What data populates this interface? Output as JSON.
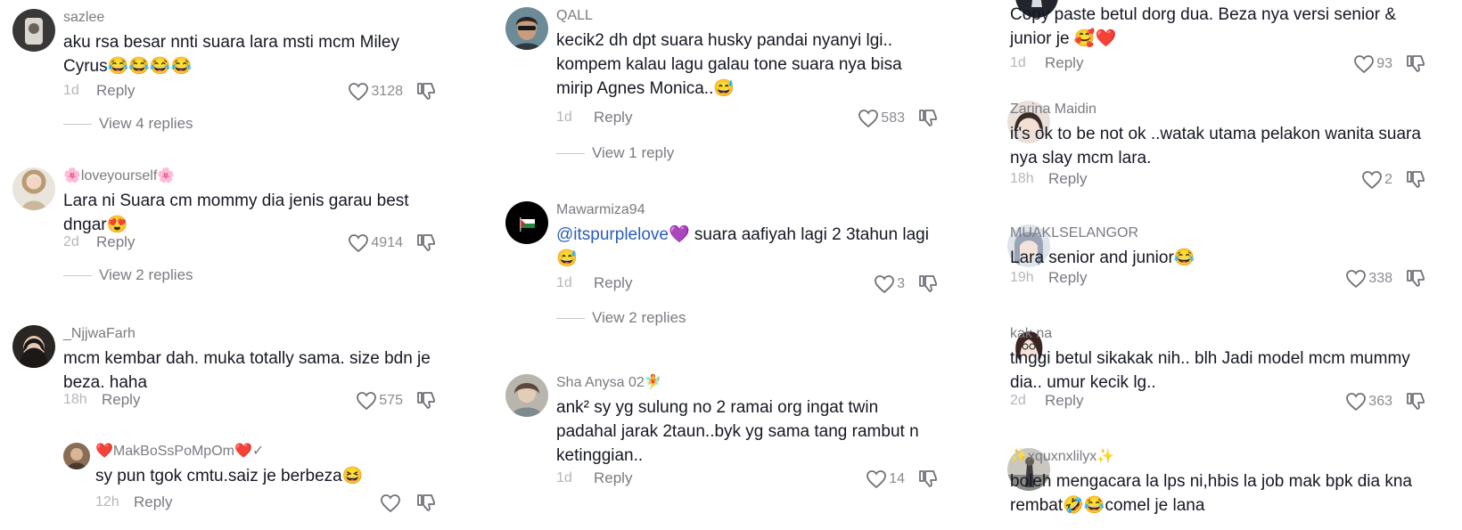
{
  "icons": {
    "like": "heart-outline-icon",
    "dislike": "thumbs-down-icon"
  },
  "columns": [
    {
      "comments": [
        {
          "username": "sazlee",
          "text": "aku rsa besar nnti suara lara msti mcm Miley Cyrus😂😂😂😂",
          "time": "1d",
          "reply_label": "Reply",
          "likes": "3128",
          "view_replies": "View 4 replies"
        },
        {
          "username": "🌸loveyourself🌸",
          "text": "Lara ni Suara cm mommy dia jenis garau best dngar😍",
          "time": "2d",
          "reply_label": "Reply",
          "likes": "4914",
          "view_replies": "View 2 replies"
        },
        {
          "username": "_NjjwaFarh",
          "text": "mcm kembar dah. muka totally sama. size bdn je beza. haha",
          "time": "18h",
          "reply_label": "Reply",
          "likes": "575",
          "view_replies": ""
        },
        {
          "username": "❤️MakBoSsPoMpOm❤️✓",
          "text": "sy pun tgok cmtu.saiz je berbeza😆",
          "time": "12h",
          "reply_label": "Reply",
          "likes": "",
          "view_replies": ""
        }
      ]
    },
    {
      "comments": [
        {
          "username": "QALL",
          "text": "kecik2 dh dpt suara husky pandai nyanyi lgi.. kompem kalau lagu galau tone suara nya bisa mirip Agnes Monica..😅",
          "time": "1d",
          "reply_label": "Reply",
          "likes": "583",
          "view_replies": "View 1 reply"
        },
        {
          "username": "Mawarmiza94",
          "mention": "@itspurplelove💜",
          "text": " suara aafiyah lagi 2 3tahun lagi 😅",
          "time": "1d",
          "reply_label": "Reply",
          "likes": "3",
          "view_replies": "View 2 replies"
        },
        {
          "username": "Sha Anysa 02🧚",
          "text": "ank² sy yg sulung no 2 ramai org ingat twin padahal jarak 2taun..byk yg sama tang rambut n ketinggian..",
          "time": "1d",
          "reply_label": "Reply",
          "likes": "14",
          "view_replies": ""
        }
      ]
    },
    {
      "comments": [
        {
          "username": "",
          "text": "Copy paste betul dorg dua. Beza nya versi senior & junior je 🥰❤️",
          "time": "1d",
          "reply_label": "Reply",
          "likes": "93",
          "view_replies": ""
        },
        {
          "username": "Zarina Maidin",
          "text": "it's ok to be not ok ..watak utama pelakon wanita suara nya slay mcm lara.",
          "time": "18h",
          "reply_label": "Reply",
          "likes": "2",
          "view_replies": ""
        },
        {
          "username": "MUAKLSELANGOR",
          "text": "Lara senior and junior😂",
          "time": "19h",
          "reply_label": "Reply",
          "likes": "338",
          "view_replies": ""
        },
        {
          "username": "kak na",
          "text": "tinggi betul sikakak nih.. blh Jadi model mcm mummy dia.. umur kecik lg..",
          "time": "2d",
          "reply_label": "Reply",
          "likes": "363",
          "view_replies": ""
        },
        {
          "username": "✨xquxnxlilyx✨",
          "text": "boleh mengacara la lps ni,hbis la job mak bpk dia kna rembat🤣😂comel je lana",
          "time": "",
          "reply_label": "",
          "likes": "",
          "view_replies": ""
        }
      ]
    }
  ]
}
